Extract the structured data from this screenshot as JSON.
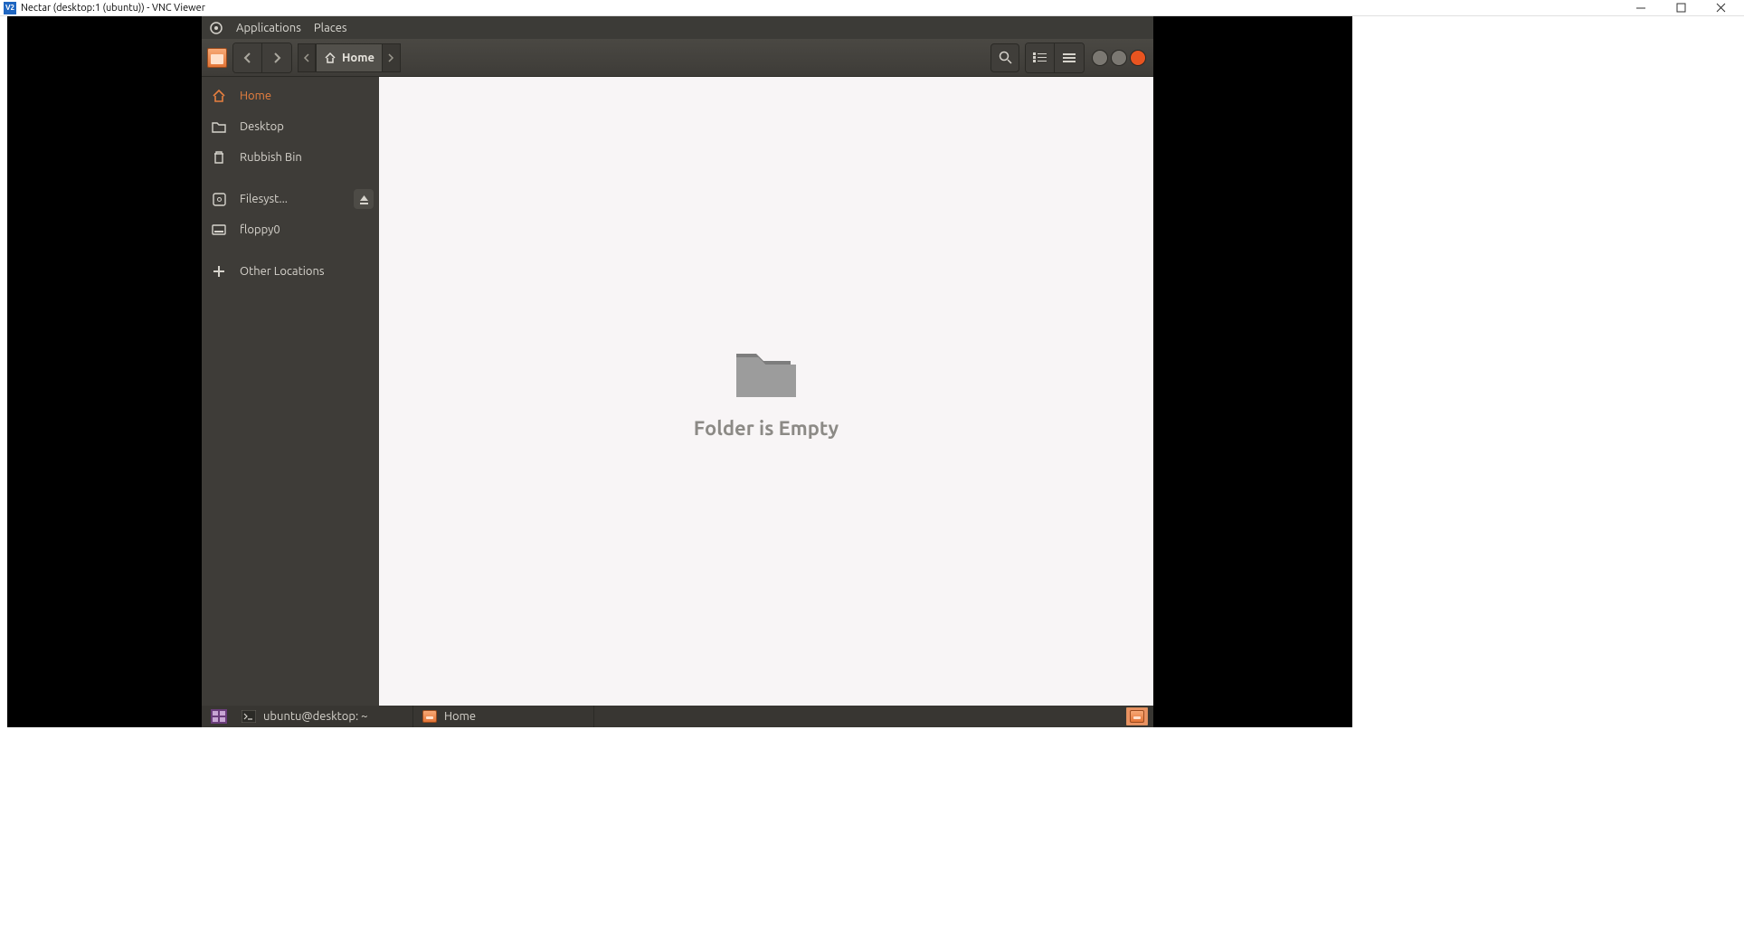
{
  "host_window": {
    "title": "Nectar (desktop:1 (ubuntu)) - VNC Viewer",
    "logo_text": "V2"
  },
  "ubuntu_menubar": {
    "applications": "Applications",
    "places": "Places"
  },
  "nautilus": {
    "breadcrumb_home": "Home",
    "sidebar": {
      "home": "Home",
      "desktop": "Desktop",
      "trash": "Rubbish Bin",
      "filesystem": "Filesyst...",
      "floppy": "floppy0",
      "other": "Other Locations"
    },
    "empty_folder_text": "Folder is Empty"
  },
  "panel": {
    "terminal_title": "ubuntu@desktop: ~",
    "files_title": "Home"
  }
}
